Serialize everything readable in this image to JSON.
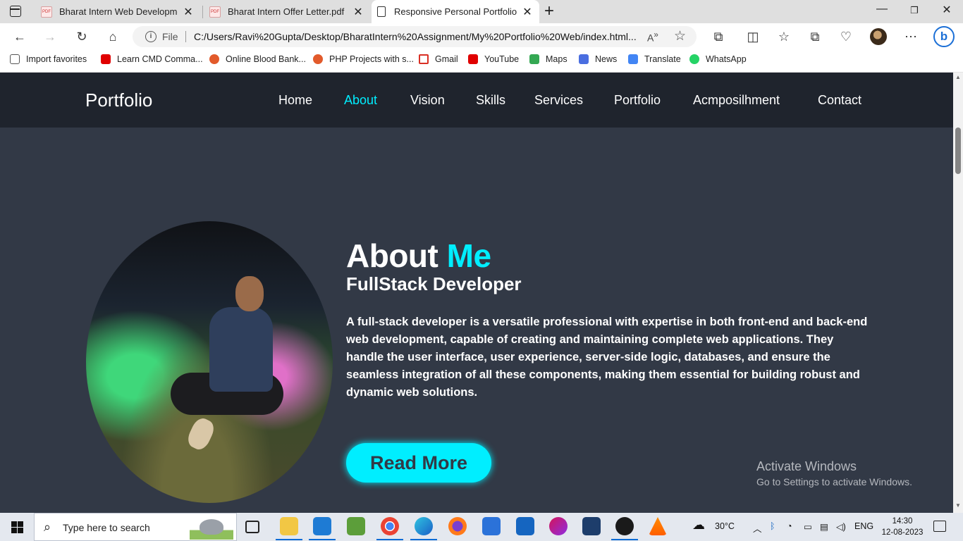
{
  "browser": {
    "tabs": [
      {
        "title": "Bharat Intern Web Development",
        "icon": "pdf-icon"
      },
      {
        "title": "Bharat Intern Offer Letter.pdf",
        "icon": "pdf-icon"
      },
      {
        "title": "Responsive Personal Portfolio We",
        "icon": "page-icon",
        "active": true
      }
    ],
    "address": {
      "scheme": "File",
      "url": "C:/Users/Ravi%20Gupta/Desktop/BharatIntern%20Assignment/My%20Portfolio%20Web/index.html..."
    },
    "favorites": [
      {
        "label": "Import favorites",
        "color": "#555555"
      },
      {
        "label": "Learn CMD Comma...",
        "color": "#e00000"
      },
      {
        "label": "Online Blood Bank...",
        "color": "#e25a2b"
      },
      {
        "label": "PHP Projects with s...",
        "color": "#e25a2b"
      },
      {
        "label": "Gmail",
        "color": "#d93025"
      },
      {
        "label": "YouTube",
        "color": "#e00000"
      },
      {
        "label": "Maps",
        "color": "#34a853"
      },
      {
        "label": "News",
        "color": "#4a6ee0"
      },
      {
        "label": "Translate",
        "color": "#4285f4"
      },
      {
        "label": "WhatsApp",
        "color": "#25d366"
      }
    ]
  },
  "site": {
    "logo": "Portfolio",
    "nav": [
      "Home",
      "About",
      "Vision",
      "Skills",
      "Services",
      "Portfolio",
      "Acmposilhment",
      "Contact"
    ],
    "active_nav": "About",
    "accent_color": "#00eeff",
    "about": {
      "heading": "About",
      "heading_accent": "Me",
      "subheading": "FullStack Developer",
      "paragraph": "A full-stack developer is a versatile professional with expertise in both front-end and back-end web development, capable of creating and maintaining complete web applications. They handle the user interface, user experience, server-side logic, databases, and ensure the seamless integration of all these components, making them essential for building robust and dynamic web solutions.",
      "button": "Read More"
    },
    "watermark": {
      "line1": "Activate Windows",
      "line2": "Go to Settings to activate Windows."
    }
  },
  "taskbar": {
    "search_placeholder": "Type here to search",
    "weather": "30°C",
    "language": "ENG",
    "time": "14:30",
    "date": "12-08-2023"
  }
}
